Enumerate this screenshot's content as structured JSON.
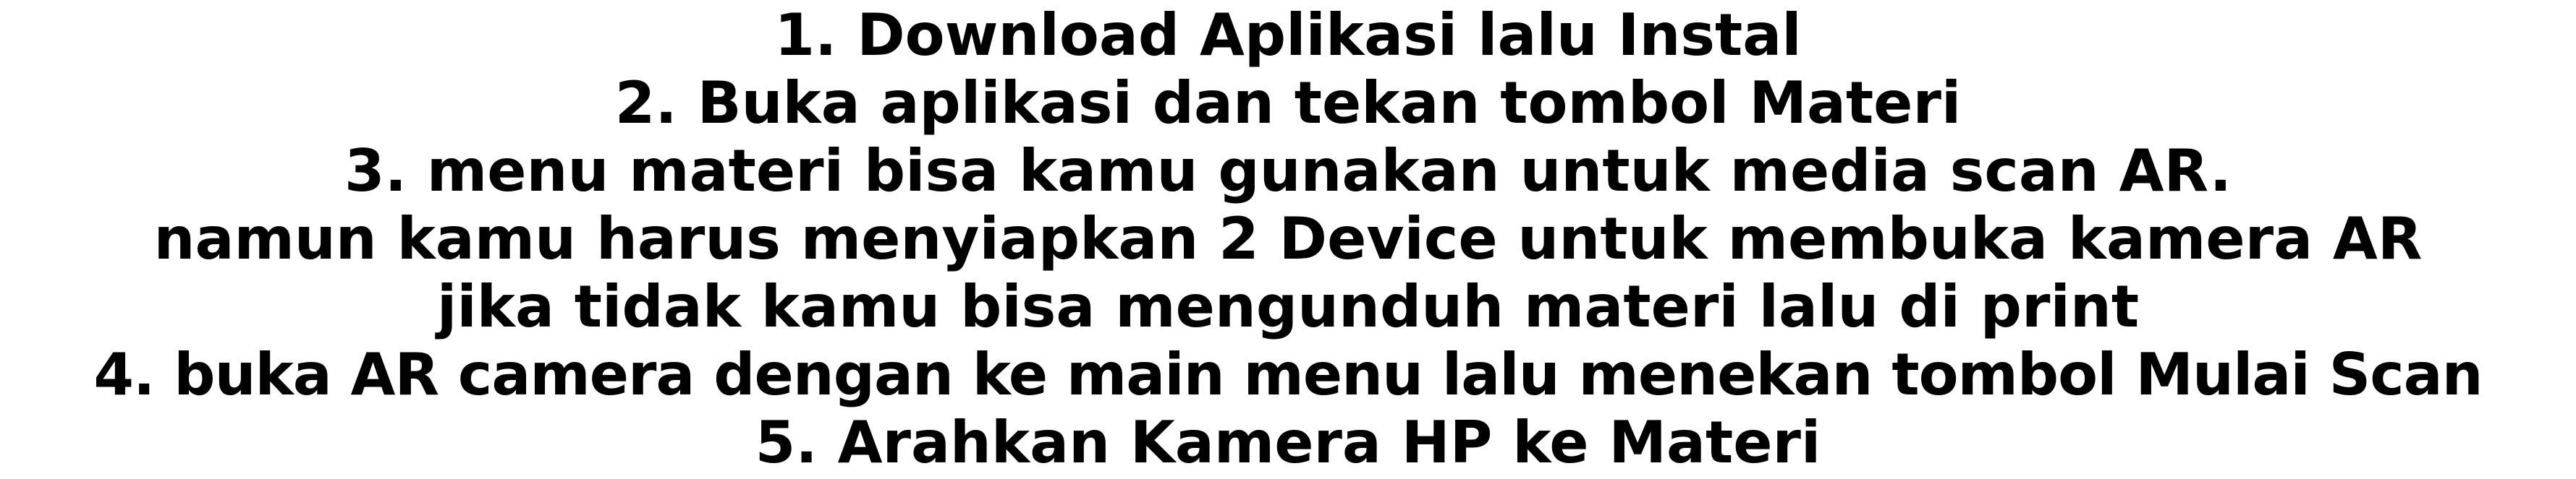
{
  "instructions": {
    "lines": [
      "1. Download Aplikasi lalu Instal",
      "2. Buka aplikasi dan tekan tombol Materi",
      "3. menu materi bisa kamu gunakan untuk media scan AR.",
      "namun kamu harus menyiapkan 2 Device untuk membuka kamera AR",
      "jika tidak kamu bisa mengunduh materi lalu di print",
      "4. buka AR camera dengan ke main menu lalu menekan tombol Mulai Scan",
      "5. Arahkan Kamera HP ke Materi"
    ]
  },
  "colors": {
    "text": "#000000",
    "background": "#ffffff"
  }
}
